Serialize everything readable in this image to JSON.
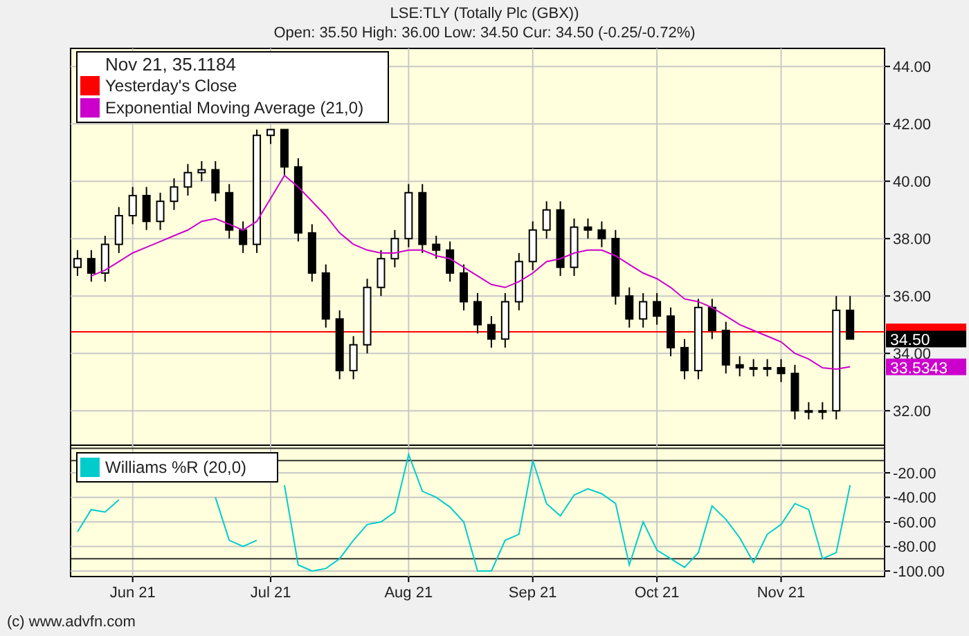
{
  "header": {
    "title": "LSE:TLY (Totally Plc (GBX))",
    "quote": "Open: 35.50 High: 36.00 Low: 34.50 Cur: 34.50 (-0.25/-0.72%)"
  },
  "price_panel": {
    "legend": {
      "title": "Nov 21, 35.1184"
    },
    "chart_data": {
      "type": "candlestick",
      "grid": true,
      "ylim": [
        30.8,
        44.63
      ],
      "yticks": [
        {
          "value": 32,
          "label": "32.00"
        },
        {
          "value": 34,
          "label": "34.00"
        },
        {
          "value": 36,
          "label": "36.00"
        },
        {
          "value": 38,
          "label": "38.00"
        },
        {
          "value": 40,
          "label": "40.00"
        },
        {
          "value": 42,
          "label": "42.00"
        },
        {
          "value": 44,
          "label": "44.00"
        }
      ],
      "categories": [
        null,
        null,
        null,
        null,
        null,
        null,
        null,
        null,
        null,
        null,
        null,
        null,
        null,
        null,
        null,
        null,
        null,
        null,
        null,
        null,
        null,
        null,
        null,
        null,
        null,
        null,
        null,
        null,
        null,
        null,
        null,
        null,
        null,
        null,
        null,
        null,
        null,
        null,
        null,
        null,
        null,
        null,
        null,
        null,
        null,
        null,
        null,
        null,
        null,
        null,
        null,
        null,
        null,
        null,
        null,
        null,
        null,
        null,
        null
      ],
      "ohlc": [
        [
          37.0,
          37.6,
          36.7,
          37.3
        ],
        [
          37.3,
          37.6,
          36.5,
          36.8
        ],
        [
          36.8,
          38.1,
          36.5,
          37.8
        ],
        [
          37.8,
          39.1,
          37.5,
          38.8
        ],
        [
          38.8,
          39.8,
          38.5,
          39.5
        ],
        [
          39.5,
          39.8,
          38.3,
          38.6
        ],
        [
          38.6,
          39.6,
          38.3,
          39.3
        ],
        [
          39.3,
          40.1,
          39.0,
          39.8
        ],
        [
          39.8,
          40.6,
          39.5,
          40.3
        ],
        [
          40.3,
          40.7,
          40.0,
          40.4
        ],
        [
          40.4,
          40.7,
          39.3,
          39.6
        ],
        [
          39.6,
          39.9,
          38.0,
          38.3
        ],
        [
          38.3,
          38.6,
          37.5,
          37.8
        ],
        [
          37.8,
          41.8,
          37.5,
          41.6
        ],
        [
          41.6,
          41.8,
          41.3,
          41.8
        ],
        [
          41.8,
          41.8,
          40.2,
          40.5
        ],
        [
          40.5,
          40.8,
          37.9,
          38.2
        ],
        [
          38.2,
          38.5,
          36.5,
          36.8
        ],
        [
          36.8,
          37.1,
          34.9,
          35.2
        ],
        [
          35.2,
          35.5,
          33.1,
          33.4
        ],
        [
          33.4,
          34.6,
          33.1,
          34.3
        ],
        [
          34.3,
          36.6,
          34.0,
          36.3
        ],
        [
          36.3,
          37.6,
          36.0,
          37.3
        ],
        [
          37.3,
          38.3,
          37.0,
          38.0
        ],
        [
          38.0,
          39.9,
          37.7,
          39.6
        ],
        [
          39.6,
          39.9,
          37.5,
          37.8
        ],
        [
          37.8,
          38.1,
          37.3,
          37.6
        ],
        [
          37.6,
          37.9,
          36.5,
          36.8
        ],
        [
          36.8,
          37.1,
          35.5,
          35.8
        ],
        [
          35.8,
          36.1,
          34.7,
          35.0
        ],
        [
          35.0,
          35.3,
          34.2,
          34.5
        ],
        [
          34.5,
          36.1,
          34.2,
          35.8
        ],
        [
          35.8,
          37.5,
          35.5,
          37.2
        ],
        [
          37.2,
          38.6,
          36.9,
          38.3
        ],
        [
          38.3,
          39.3,
          38.0,
          39.0
        ],
        [
          39.0,
          39.3,
          36.7,
          37.0
        ],
        [
          37.0,
          38.7,
          36.7,
          38.4
        ],
        [
          38.4,
          38.7,
          38.0,
          38.3
        ],
        [
          38.3,
          38.6,
          37.7,
          38.0
        ],
        [
          38.0,
          38.3,
          35.7,
          36.0
        ],
        [
          36.0,
          36.3,
          34.9,
          35.2
        ],
        [
          35.2,
          36.1,
          34.9,
          35.8
        ],
        [
          35.8,
          36.1,
          35.0,
          35.3
        ],
        [
          35.3,
          35.6,
          33.9,
          34.2
        ],
        [
          34.2,
          34.5,
          33.1,
          33.4
        ],
        [
          33.4,
          35.9,
          33.1,
          35.6
        ],
        [
          35.6,
          35.9,
          34.5,
          34.8
        ],
        [
          34.8,
          35.1,
          33.3,
          33.6
        ],
        [
          33.6,
          33.9,
          33.2,
          33.5
        ],
        [
          33.5,
          33.8,
          33.2,
          33.5
        ],
        [
          33.5,
          33.8,
          33.2,
          33.5
        ],
        [
          33.5,
          33.8,
          33.0,
          33.3
        ],
        [
          33.3,
          33.6,
          31.7,
          32.0
        ],
        [
          32.0,
          32.3,
          31.7,
          32.0
        ],
        [
          32.0,
          32.3,
          31.7,
          32.0
        ],
        [
          32.0,
          36.0,
          31.7,
          35.5
        ],
        [
          35.5,
          36.0,
          34.5,
          34.5
        ],
        null,
        null
      ],
      "series": [
        {
          "name": "Exponential Moving Average (21,0)",
          "type": "line",
          "color": "#cc00cc",
          "values": [
            null,
            36.7,
            36.9,
            37.2,
            37.5,
            37.7,
            37.9,
            38.1,
            38.3,
            38.6,
            38.7,
            38.5,
            38.3,
            38.6,
            39.4,
            40.2,
            39.8,
            39.3,
            38.8,
            38.2,
            37.8,
            37.6,
            37.5,
            37.5,
            37.6,
            37.6,
            37.4,
            37.3,
            37.0,
            36.7,
            36.4,
            36.3,
            36.5,
            36.8,
            37.2,
            37.3,
            37.5,
            37.6,
            37.6,
            37.4,
            37.1,
            36.8,
            36.6,
            36.3,
            35.9,
            35.8,
            35.6,
            35.3,
            35.0,
            34.8,
            34.6,
            34.4,
            34.0,
            33.8,
            33.5,
            33.45,
            33.53,
            null,
            null
          ]
        }
      ],
      "ref_lines": [
        {
          "axis": "y",
          "value": 34.75,
          "label": "Yesterday's Close",
          "color": "#ff0000"
        }
      ],
      "annotations": [
        "34.50",
        "33.5343"
      ]
    }
  },
  "indicator_panel": {
    "chart_data": {
      "type": "line",
      "grid": true,
      "ylim": [
        -104.5,
        2.5
      ],
      "categories": [
        null,
        null,
        null,
        null,
        "Jun 21",
        null,
        null,
        null,
        null,
        null,
        null,
        null,
        null,
        null,
        "Jul 21",
        null,
        null,
        null,
        null,
        null,
        null,
        null,
        null,
        null,
        "Aug 21",
        null,
        null,
        null,
        null,
        null,
        null,
        null,
        null,
        "Sep 21",
        null,
        null,
        null,
        null,
        null,
        null,
        null,
        null,
        "Oct 21",
        null,
        null,
        null,
        null,
        null,
        null,
        null,
        null,
        "Nov 21",
        null,
        null,
        null,
        null,
        null,
        null,
        null
      ],
      "yticks": [
        {
          "value": -20,
          "label": "-20.00"
        },
        {
          "value": -40,
          "label": "-40.00"
        },
        {
          "value": -60,
          "label": "-60.00"
        },
        {
          "value": -80,
          "label": "-80.00"
        },
        {
          "value": -100,
          "label": "-100.00"
        }
      ],
      "series": [
        {
          "name": "Williams %R (20,0)",
          "color": "#00cccc",
          "values": [
            -68,
            -50,
            -52,
            -42,
            null,
            null,
            null,
            null,
            null,
            null,
            -40,
            -75,
            -80,
            -75,
            null,
            -30,
            -95,
            -100,
            -98,
            -90,
            -75,
            -62,
            -60,
            -52,
            -5,
            -35,
            -40,
            -48,
            -60,
            -100,
            -100,
            -75,
            -70,
            -10,
            -45,
            -55,
            -38,
            -33,
            -37,
            -45,
            -95,
            -60,
            -83,
            -90,
            -97,
            -85,
            -47,
            -58,
            -73,
            -93,
            -70,
            -62,
            -45,
            -50,
            -90,
            -85,
            -30,
            null,
            null
          ]
        }
      ],
      "ref_lines": [
        {
          "axis": "y",
          "value": 0
        },
        {
          "axis": "y",
          "value": -10
        },
        {
          "axis": "y",
          "value": -90
        }
      ]
    }
  },
  "footer": {
    "copyright": "(c) www.advfn.com"
  }
}
